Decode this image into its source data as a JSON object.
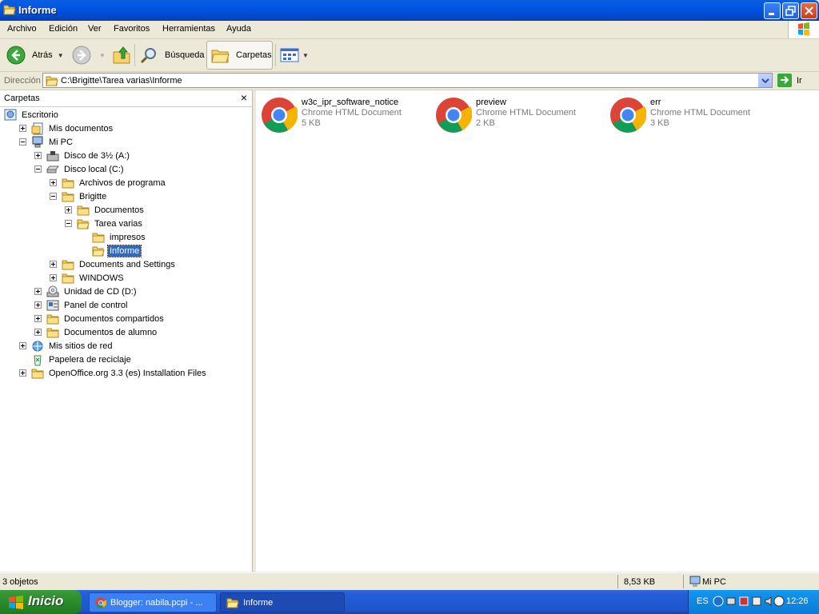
{
  "window": {
    "title": "Informe"
  },
  "menu": [
    "Archivo",
    "Edición",
    "Ver",
    "Favoritos",
    "Herramientas",
    "Ayuda"
  ],
  "toolbar": {
    "back": "Atrás",
    "search": "Búsqueda",
    "folders": "Carpetas"
  },
  "address": {
    "label": "Dirección",
    "path": "C:\\Brigitte\\Tarea varias\\Informe",
    "go": "Ir"
  },
  "folders_pane": {
    "title": "Carpetas",
    "close": "×",
    "tree": [
      {
        "label": "Escritorio",
        "depth": 0,
        "toggle": "none",
        "icon": "desktop-icon"
      },
      {
        "label": "Mis documentos",
        "depth": 1,
        "toggle": "plus",
        "icon": "my-documents-icon"
      },
      {
        "label": "Mi PC",
        "depth": 1,
        "toggle": "minus",
        "icon": "my-computer-icon"
      },
      {
        "label": "Disco de 3½ (A:)",
        "depth": 2,
        "toggle": "plus",
        "icon": "floppy-drive-icon"
      },
      {
        "label": "Disco local (C:)",
        "depth": 2,
        "toggle": "minus",
        "icon": "hard-drive-icon"
      },
      {
        "label": "Archivos de programa",
        "depth": 3,
        "toggle": "plus",
        "icon": "folder-icon"
      },
      {
        "label": "Brigitte",
        "depth": 3,
        "toggle": "minus",
        "icon": "folder-icon"
      },
      {
        "label": "Documentos",
        "depth": 4,
        "toggle": "plus",
        "icon": "folder-icon"
      },
      {
        "label": "Tarea varias",
        "depth": 4,
        "toggle": "minus",
        "icon": "folder-open-icon"
      },
      {
        "label": "impresos",
        "depth": 5,
        "toggle": "none",
        "icon": "folder-icon"
      },
      {
        "label": "Informe",
        "depth": 5,
        "toggle": "none",
        "icon": "folder-open-icon",
        "selected": true
      },
      {
        "label": "Documents and Settings",
        "depth": 3,
        "toggle": "plus",
        "icon": "folder-icon"
      },
      {
        "label": "WINDOWS",
        "depth": 3,
        "toggle": "plus",
        "icon": "folder-icon"
      },
      {
        "label": "Unidad de CD (D:)",
        "depth": 2,
        "toggle": "plus",
        "icon": "cd-drive-icon"
      },
      {
        "label": "Panel de control",
        "depth": 2,
        "toggle": "plus",
        "icon": "control-panel-icon"
      },
      {
        "label": "Documentos compartidos",
        "depth": 2,
        "toggle": "plus",
        "icon": "folder-icon"
      },
      {
        "label": "Documentos de alumno",
        "depth": 2,
        "toggle": "plus",
        "icon": "folder-icon"
      },
      {
        "label": "Mis sitios de red",
        "depth": 1,
        "toggle": "plus",
        "icon": "network-places-icon"
      },
      {
        "label": "Papelera de reciclaje",
        "depth": 1,
        "toggle": "none",
        "icon": "recycle-bin-icon"
      },
      {
        "label": "OpenOffice.org 3.3 (es) Installation Files",
        "depth": 1,
        "toggle": "plus",
        "icon": "folder-icon"
      }
    ]
  },
  "files": [
    {
      "name": "w3c_ipr_software_notice",
      "type": "Chrome HTML Document",
      "size": "5 KB",
      "icon": "chrome-icon"
    },
    {
      "name": "preview",
      "type": "Chrome HTML Document",
      "size": "2 KB",
      "icon": "chrome-icon"
    },
    {
      "name": "err",
      "type": "Chrome HTML Document",
      "size": "3 KB",
      "icon": "chrome-icon"
    }
  ],
  "status": {
    "count": "3 objetos",
    "size": "8,53 KB",
    "location": "Mi PC"
  },
  "taskbar": {
    "start": "Inicio",
    "tasks": [
      {
        "label": "Blogger: nabila.pcpi - ...",
        "icon": "chrome-icon"
      },
      {
        "label": "Informe",
        "icon": "folder-open-icon"
      }
    ],
    "language": "ES",
    "clock": "12:26"
  }
}
